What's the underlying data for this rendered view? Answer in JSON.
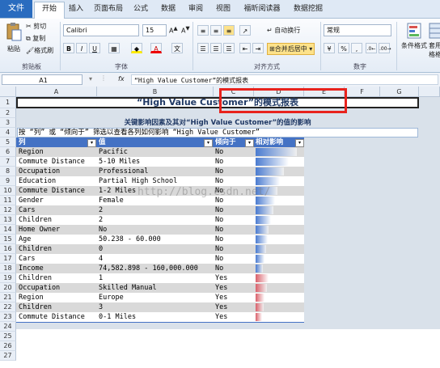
{
  "tabs": [
    "文件",
    "开始",
    "插入",
    "页面布局",
    "公式",
    "数据",
    "审阅",
    "视图",
    "福昕阅读器",
    "数据挖掘"
  ],
  "ribbon": {
    "clipboard": {
      "paste": "粘贴",
      "cut": "剪切",
      "copy": "复制",
      "format_painter": "格式刷",
      "label": "剪贴板"
    },
    "font": {
      "name": "Calibri",
      "size": "15",
      "bold": "B",
      "italic": "I",
      "underline": "U",
      "font_color": "A",
      "label": "字体"
    },
    "alignment": {
      "wrap": "自动换行",
      "merge": "合并后居中",
      "label": "对齐方式"
    },
    "number": {
      "format": "常规",
      "percent": "%",
      "comma": ",",
      "label": "数字"
    },
    "styles": {
      "conditional": "条件格式",
      "format_as_table": "套用表格格式"
    }
  },
  "formula_bar": {
    "name_box": "A1",
    "fx": "fx",
    "formula": "“High Value Customer”的模式报表"
  },
  "columns": [
    "A",
    "B",
    "C",
    "D",
    "E",
    "F",
    "G"
  ],
  "rows": [
    "1",
    "2",
    "3",
    "4",
    "5",
    "6",
    "7",
    "8",
    "9",
    "10",
    "11",
    "12",
    "13",
    "14",
    "15",
    "16",
    "17",
    "18",
    "19",
    "20",
    "21",
    "22",
    "23",
    "24",
    "25",
    "26",
    "27"
  ],
  "sheet": {
    "title": "“High Value Customer”的模式报表",
    "subtitle": "关键影响因素及其对“High Value Customer”的值的影响",
    "filter_note": "按 “列” 或 “倾向于” 筛选以查看各列如何影响 “High Value Customer”",
    "headers": {
      "col": "列",
      "value": "值",
      "favors": "倾向于",
      "impact": "相对影响"
    },
    "data": [
      {
        "col": "Region",
        "value": "Pacific",
        "favors": "No",
        "impact": 0.95
      },
      {
        "col": "Commute Distance",
        "value": "5-10 Miles",
        "favors": "No",
        "impact": 0.75
      },
      {
        "col": "Occupation",
        "value": "Professional",
        "favors": "No",
        "impact": 0.65
      },
      {
        "col": "Education",
        "value": "Partial High School",
        "favors": "No",
        "impact": 0.55
      },
      {
        "col": "Commute Distance",
        "value": "1-2 Miles",
        "favors": "No",
        "impact": 0.5
      },
      {
        "col": "Gender",
        "value": "Female",
        "favors": "No",
        "impact": 0.45
      },
      {
        "col": "Cars",
        "value": "2",
        "favors": "No",
        "impact": 0.4
      },
      {
        "col": "Children",
        "value": "2",
        "favors": "No",
        "impact": 0.35
      },
      {
        "col": "Home Owner",
        "value": "No",
        "favors": "No",
        "impact": 0.3
      },
      {
        "col": "Age",
        "value": "50.238 - 60.000",
        "favors": "No",
        "impact": 0.27
      },
      {
        "col": "Children",
        "value": "0",
        "favors": "No",
        "impact": 0.24
      },
      {
        "col": "Cars",
        "value": "4",
        "favors": "No",
        "impact": 0.2
      },
      {
        "col": "Income",
        "value": "74,582.898 - 160,000.000",
        "favors": "No",
        "impact": 0.17
      },
      {
        "col": "Children",
        "value": "1",
        "favors": "Yes",
        "impact": 0.3
      },
      {
        "col": "Occupation",
        "value": "Skilled Manual",
        "favors": "Yes",
        "impact": 0.25
      },
      {
        "col": "Region",
        "value": "Europe",
        "favors": "Yes",
        "impact": 0.2
      },
      {
        "col": "Children",
        "value": "3",
        "favors": "Yes",
        "impact": 0.18
      },
      {
        "col": "Commute Distance",
        "value": "0-1 Miles",
        "favors": "Yes",
        "impact": 0.15
      }
    ]
  },
  "watermark": "http://blog.csdn.net/",
  "colors": {
    "title": "#1f3864",
    "header_bg": "#4472c4",
    "band": "#d9d9d9",
    "bar_no": "#4a7bd0",
    "bar_yes": "#d9606a",
    "highlight": "#e8231d"
  }
}
